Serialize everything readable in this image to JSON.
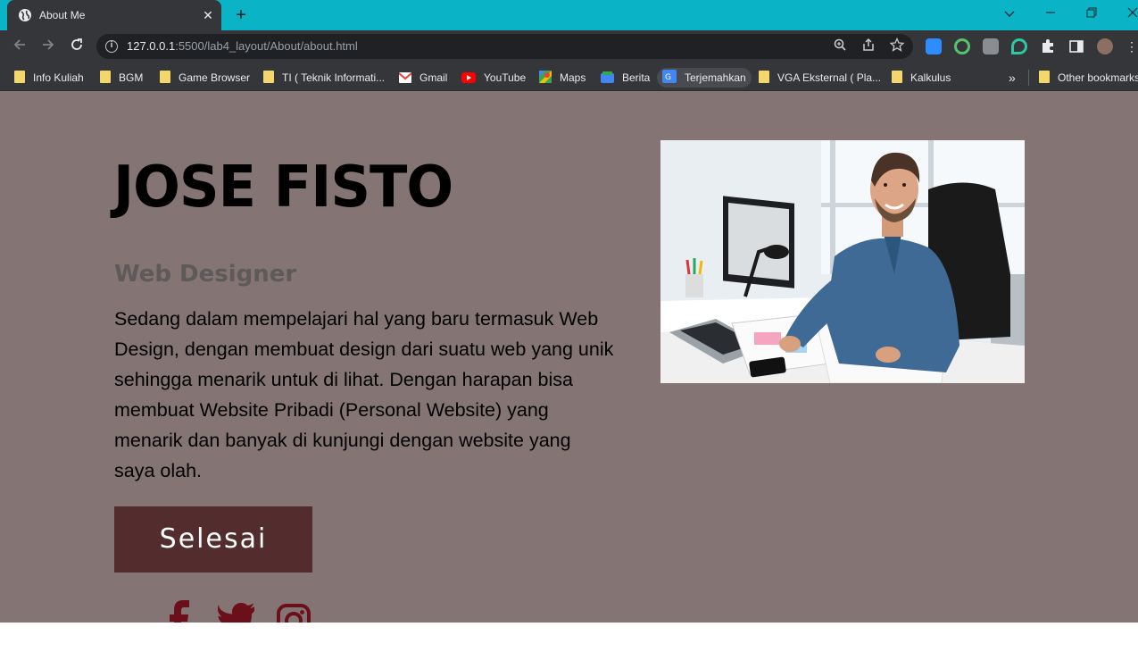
{
  "browser": {
    "tab_title": "About Me",
    "tab_close": "✕",
    "new_tab": "+",
    "url_host": "127.0.0.1",
    "url_path": ":5500/lab4_layout/About/about.html",
    "bookmarks": [
      {
        "label": "Info Kuliah",
        "icon": "folder-icon"
      },
      {
        "label": "BGM",
        "icon": "folder-icon"
      },
      {
        "label": "Game Browser",
        "icon": "folder-icon"
      },
      {
        "label": "TI ( Teknik Informati...",
        "icon": "folder-icon"
      },
      {
        "label": "Gmail",
        "icon": "gmail-icon"
      },
      {
        "label": "YouTube",
        "icon": "youtube-icon"
      },
      {
        "label": "Maps",
        "icon": "maps-icon"
      },
      {
        "label": "Berita",
        "icon": "news-icon"
      },
      {
        "label": "Terjemahkan",
        "icon": "translate-icon"
      },
      {
        "label": "VGA Eksternal ( Pla...",
        "icon": "folder-icon"
      },
      {
        "label": "Kalkulus",
        "icon": "folder-icon"
      }
    ],
    "overflow": "»",
    "other_bookmarks": "Other bookmarks"
  },
  "profile": {
    "name": "JOSE FISTO",
    "role": "Web Designer",
    "description": "Sedang dalam mempelajari hal yang baru termasuk Web Design, dengan membuat design dari suatu web yang unik sehingga menarik untuk di lihat. Dengan harapan bisa membuat Website Pribadi (Personal Website) yang menarik dan banyak di kunjungi dengan website yang saya olah.",
    "button": "Selesai",
    "social": [
      "facebook-icon",
      "twitter-icon",
      "instagram-icon"
    ]
  },
  "colors": {
    "titlebar": "#0ab3c6",
    "page_bg": "#847474",
    "button_bg": "#532d2d",
    "social_icon": "#6b0f1a"
  }
}
